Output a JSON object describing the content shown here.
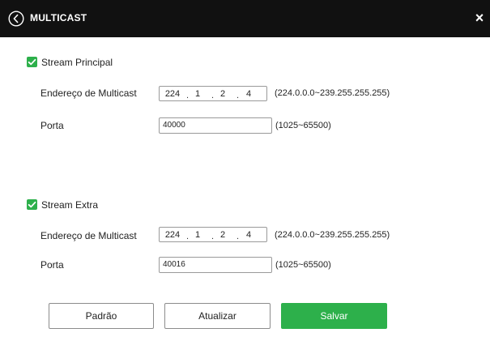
{
  "dialog": {
    "title": "MULTICAST",
    "close_label": "×",
    "back_icon": "back-arrow-circle-icon"
  },
  "principal": {
    "stream_label": "Stream Principal",
    "checked": true,
    "multicast_label": "Endereço de Multicast",
    "ip": [
      "224",
      "1",
      "2",
      "4"
    ],
    "ip_range": "(224.0.0.0~239.255.255.255)",
    "port_label": "Porta",
    "port_value": "40000",
    "port_range": "(1025~65500)"
  },
  "extra": {
    "stream_label": "Stream Extra",
    "checked": true,
    "multicast_label": "Endereço de Multicast",
    "ip": [
      "224",
      "1",
      "2",
      "4"
    ],
    "ip_range": "(224.0.0.0~239.255.255.255)",
    "port_label": "Porta",
    "port_value": "40016",
    "port_range": "(1025~65500)"
  },
  "buttons": {
    "default_label": "Padrão",
    "refresh_label": "Atualizar",
    "save_label": "Salvar"
  },
  "colors": {
    "accent": "#2db04b",
    "titlebar": "#111111"
  }
}
